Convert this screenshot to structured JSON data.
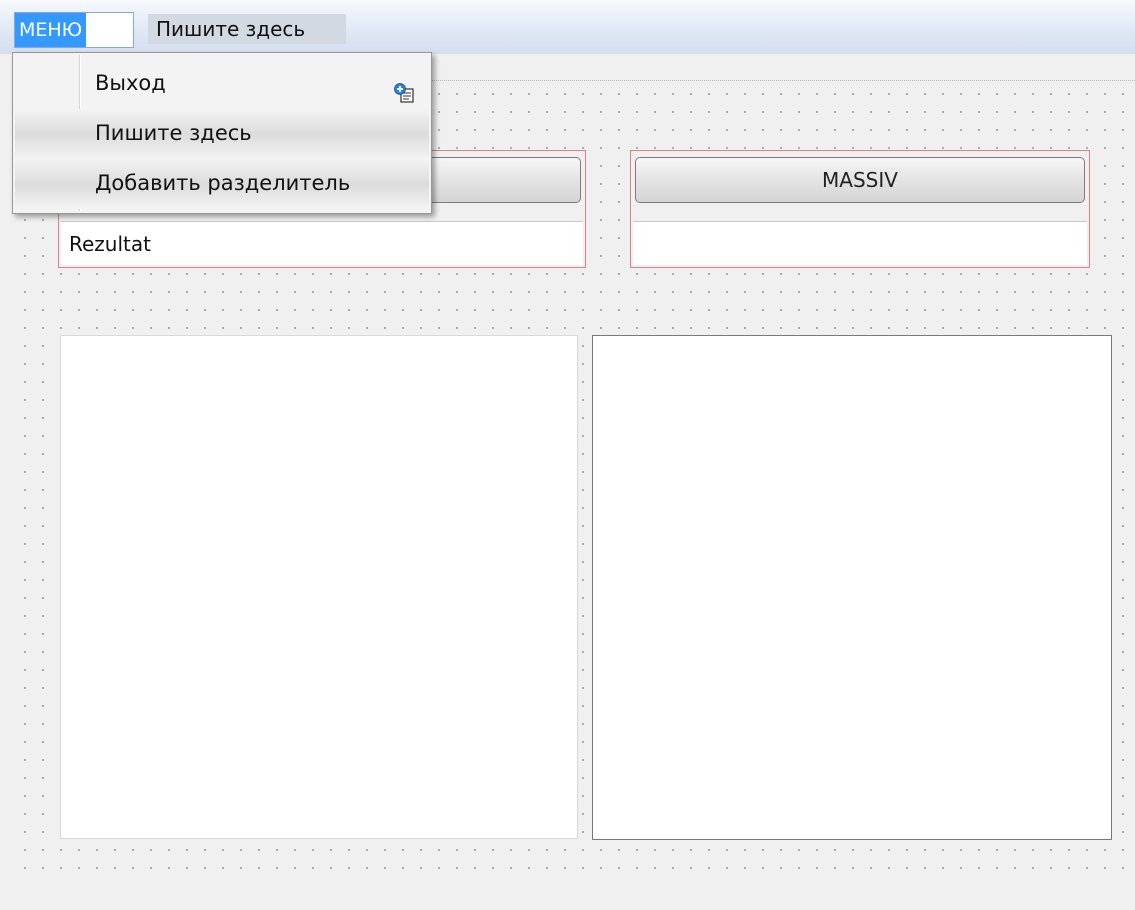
{
  "menubar": {
    "root_label": "МЕНЮ",
    "write_here": "Пишите здесь"
  },
  "dropdown": {
    "items": [
      {
        "label": "Выход",
        "icon": "add-action-icon"
      },
      {
        "label": "Пишите здесь"
      },
      {
        "label": "Добавить разделитель"
      }
    ]
  },
  "left_group": {
    "button_label": "",
    "field_value": "Rezultat"
  },
  "right_group": {
    "button_label": "MASSIV",
    "field_value": ""
  },
  "colors": {
    "selection": "#3399ff",
    "group_border": "#e0808a"
  }
}
